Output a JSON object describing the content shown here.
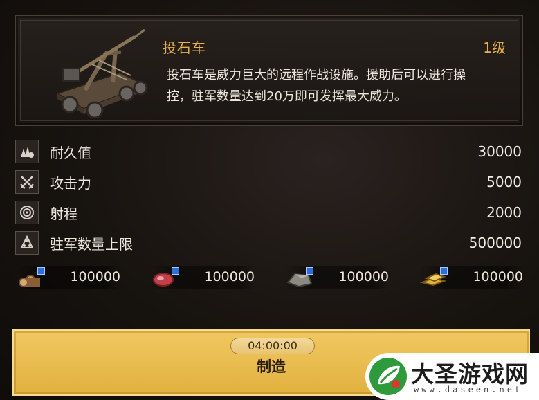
{
  "item": {
    "name": "投石车",
    "level": "1级",
    "description_line1": "投石车是威力巨大的远程作战设施。援助后可以进行操",
    "description_line2": "控，驻军数量达到20万即可发挥最大威力。",
    "thumbnail_icon": "catapult-icon"
  },
  "stats": [
    {
      "icon": "durability-icon",
      "label": "耐久值",
      "value": "30000"
    },
    {
      "icon": "crossed-swords-icon",
      "label": "攻击力",
      "value": "5000"
    },
    {
      "icon": "target-icon",
      "label": "射程",
      "value": "2000"
    },
    {
      "icon": "troops-icon",
      "label": "驻军数量上限",
      "value": "500000"
    }
  ],
  "resources": [
    {
      "icon": "wood-icon",
      "amount": "100000"
    },
    {
      "icon": "meat-icon",
      "amount": "100000"
    },
    {
      "icon": "stone-icon",
      "amount": "100000"
    },
    {
      "icon": "gold-icon",
      "amount": "100000"
    }
  ],
  "build": {
    "timer": "04:00:00",
    "label": "制造"
  },
  "watermark": {
    "title": "大圣游戏网",
    "url": "www.daseen.net"
  },
  "colors": {
    "accent": "#e8b24a",
    "button": "#e2b13f",
    "resource_badge": "#2d6fd6"
  }
}
